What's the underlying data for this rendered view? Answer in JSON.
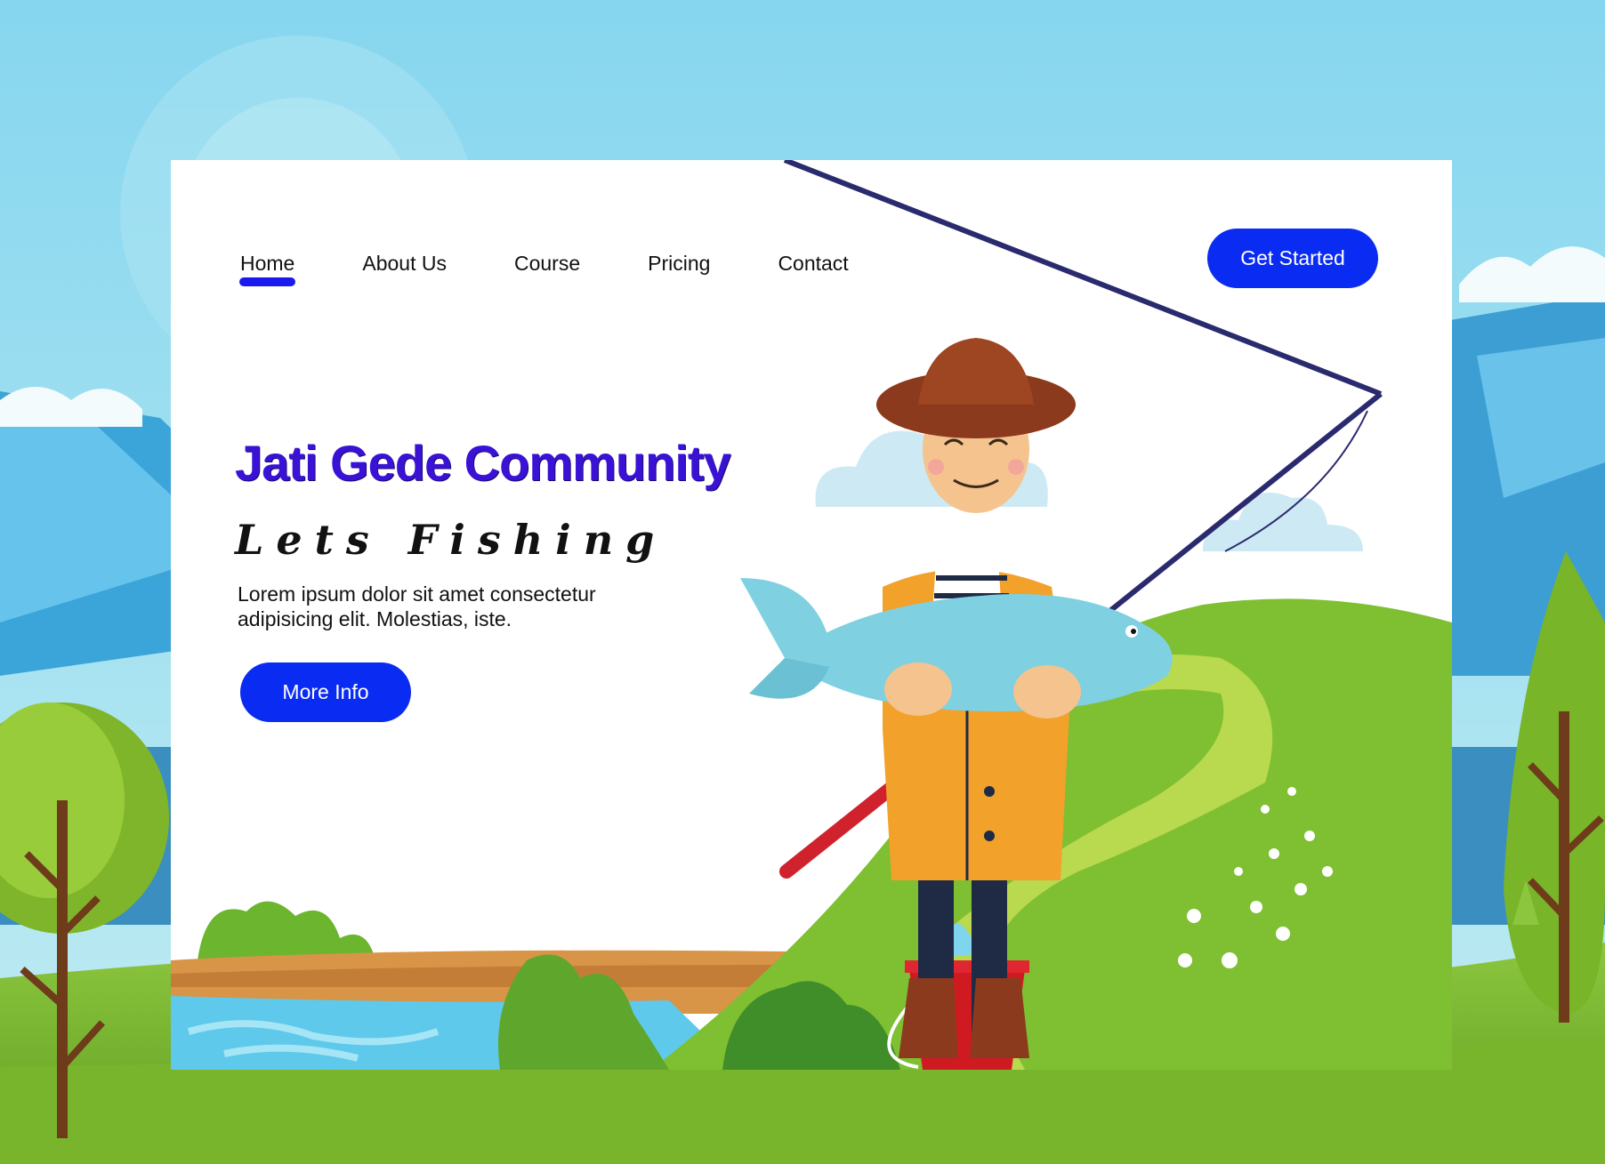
{
  "nav": {
    "items": [
      {
        "label": "Home",
        "active": true
      },
      {
        "label": "About Us",
        "active": false
      },
      {
        "label": "Course",
        "active": false
      },
      {
        "label": "Pricing",
        "active": false
      },
      {
        "label": "Contact",
        "active": false
      }
    ],
    "cta_label": "Get Started"
  },
  "hero": {
    "title": "Jati Gede Community",
    "subtitle": "Lets Fishing",
    "text": "Lorem ipsum dolor sit amet consectetur adipisicing elit. Molestias, iste.",
    "button_label": "More Info"
  },
  "colors": {
    "accent": "#0a2cf2",
    "title": "#3a12d6",
    "sky": "#8ed8ee",
    "grass": "#7dba2a"
  }
}
